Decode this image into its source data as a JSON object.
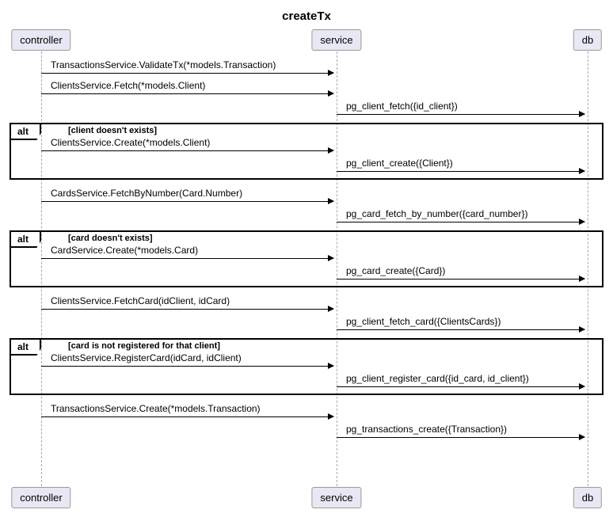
{
  "title": "createTx",
  "participants": {
    "controller": "controller",
    "service": "service",
    "db": "db"
  },
  "messages": {
    "m1": "TransactionsService.ValidateTx(*models.Transaction)",
    "m2": "ClientsService.Fetch(*models.Client)",
    "m3": "pg_client_fetch({id_client})",
    "m4": "ClientsService.Create(*models.Client)",
    "m5": "pg_client_create({Client})",
    "m6": "CardsService.FetchByNumber(Card.Number)",
    "m7": "pg_card_fetch_by_number({card_number})",
    "m8": "CardService.Create(*models.Card)",
    "m9": "pg_card_create({Card})",
    "m10": "ClientsService.FetchCard(idClient, idCard)",
    "m11": "pg_client_fetch_card({ClientsCards})",
    "m12": "ClientsService.RegisterCard(idCard, idClient)",
    "m13": "pg_client_register_card({id_card, id_client})",
    "m14": "TransactionsService.Create(*models.Transaction)",
    "m15": "pg_transactions_create({Transaction})"
  },
  "alts": {
    "label": "alt",
    "cond1": "[client doesn't exists]",
    "cond2": "[card doesn't exists]",
    "cond3": "[card is not registered for that client]"
  },
  "chart_data": {
    "type": "sequence-diagram",
    "title": "createTx",
    "participants": [
      "controller",
      "service",
      "db"
    ],
    "steps": [
      {
        "from": "controller",
        "to": "service",
        "text": "TransactionsService.ValidateTx(*models.Transaction)"
      },
      {
        "from": "controller",
        "to": "service",
        "text": "ClientsService.Fetch(*models.Client)"
      },
      {
        "from": "service",
        "to": "db",
        "text": "pg_client_fetch({id_client})"
      },
      {
        "alt": "client doesn't exists",
        "steps": [
          {
            "from": "controller",
            "to": "service",
            "text": "ClientsService.Create(*models.Client)"
          },
          {
            "from": "service",
            "to": "db",
            "text": "pg_client_create({Client})"
          }
        ]
      },
      {
        "from": "controller",
        "to": "service",
        "text": "CardsService.FetchByNumber(Card.Number)"
      },
      {
        "from": "service",
        "to": "db",
        "text": "pg_card_fetch_by_number({card_number})"
      },
      {
        "alt": "card doesn't exists",
        "steps": [
          {
            "from": "controller",
            "to": "service",
            "text": "CardService.Create(*models.Card)"
          },
          {
            "from": "service",
            "to": "db",
            "text": "pg_card_create({Card})"
          }
        ]
      },
      {
        "from": "controller",
        "to": "service",
        "text": "ClientsService.FetchCard(idClient, idCard)"
      },
      {
        "from": "service",
        "to": "db",
        "text": "pg_client_fetch_card({ClientsCards})"
      },
      {
        "alt": "card is not registered for that client",
        "steps": [
          {
            "from": "controller",
            "to": "service",
            "text": "ClientsService.RegisterCard(idCard, idClient)"
          },
          {
            "from": "service",
            "to": "db",
            "text": "pg_client_register_card({id_card, id_client})"
          }
        ]
      },
      {
        "from": "controller",
        "to": "service",
        "text": "TransactionsService.Create(*models.Transaction)"
      },
      {
        "from": "service",
        "to": "db",
        "text": "pg_transactions_create({Transaction})"
      }
    ]
  }
}
